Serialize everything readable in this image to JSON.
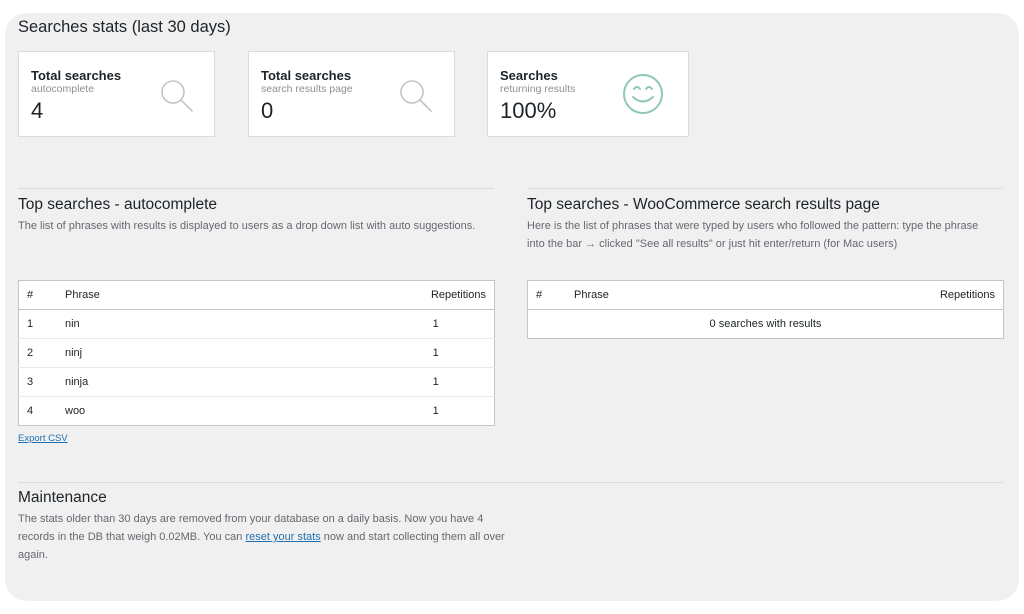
{
  "page": {
    "title": "Searches stats (last 30 days)"
  },
  "cards": [
    {
      "title": "Total searches",
      "subtitle": "autocomplete",
      "value": "4",
      "icon": "search-icon"
    },
    {
      "title": "Total searches",
      "subtitle": "search results page",
      "value": "0",
      "icon": "search-icon"
    },
    {
      "title": "Searches",
      "subtitle": "returning results",
      "value": "100%",
      "icon": "smiley-icon"
    }
  ],
  "autocomplete": {
    "title": "Top searches - autocomplete",
    "description": "The list of phrases with results is displayed to users as a drop down list with auto suggestions.",
    "headers": {
      "num": "#",
      "phrase": "Phrase",
      "reps": "Repetitions"
    },
    "rows": [
      {
        "num": "1",
        "phrase": "nin",
        "reps": "1"
      },
      {
        "num": "2",
        "phrase": "ninj",
        "reps": "1"
      },
      {
        "num": "3",
        "phrase": "ninja",
        "reps": "1"
      },
      {
        "num": "4",
        "phrase": "woo",
        "reps": "1"
      }
    ],
    "export_label": "Export CSV"
  },
  "results_page": {
    "title": "Top searches - WooCommerce search results page",
    "description": "Here is the list of phrases that were typed by users who followed the pattern: type the phrase into the bar → clicked \"See all results\" or just hit enter/return (for Mac users)",
    "headers": {
      "num": "#",
      "phrase": "Phrase",
      "reps": "Repetitions"
    },
    "empty_message": "0 searches with results"
  },
  "maintenance": {
    "title": "Maintenance",
    "text_before": "The stats older than 30 days are removed from your database on a daily basis. Now you have 4 records in the DB that weigh 0.02MB. You can ",
    "link_label": "reset your stats",
    "text_after": " now and start collecting them all over again."
  },
  "colors": {
    "panel": "#f0f0f1",
    "link": "#2271b1",
    "smiley": "#8fc9b3",
    "search_icon": "#c3c4c7"
  }
}
